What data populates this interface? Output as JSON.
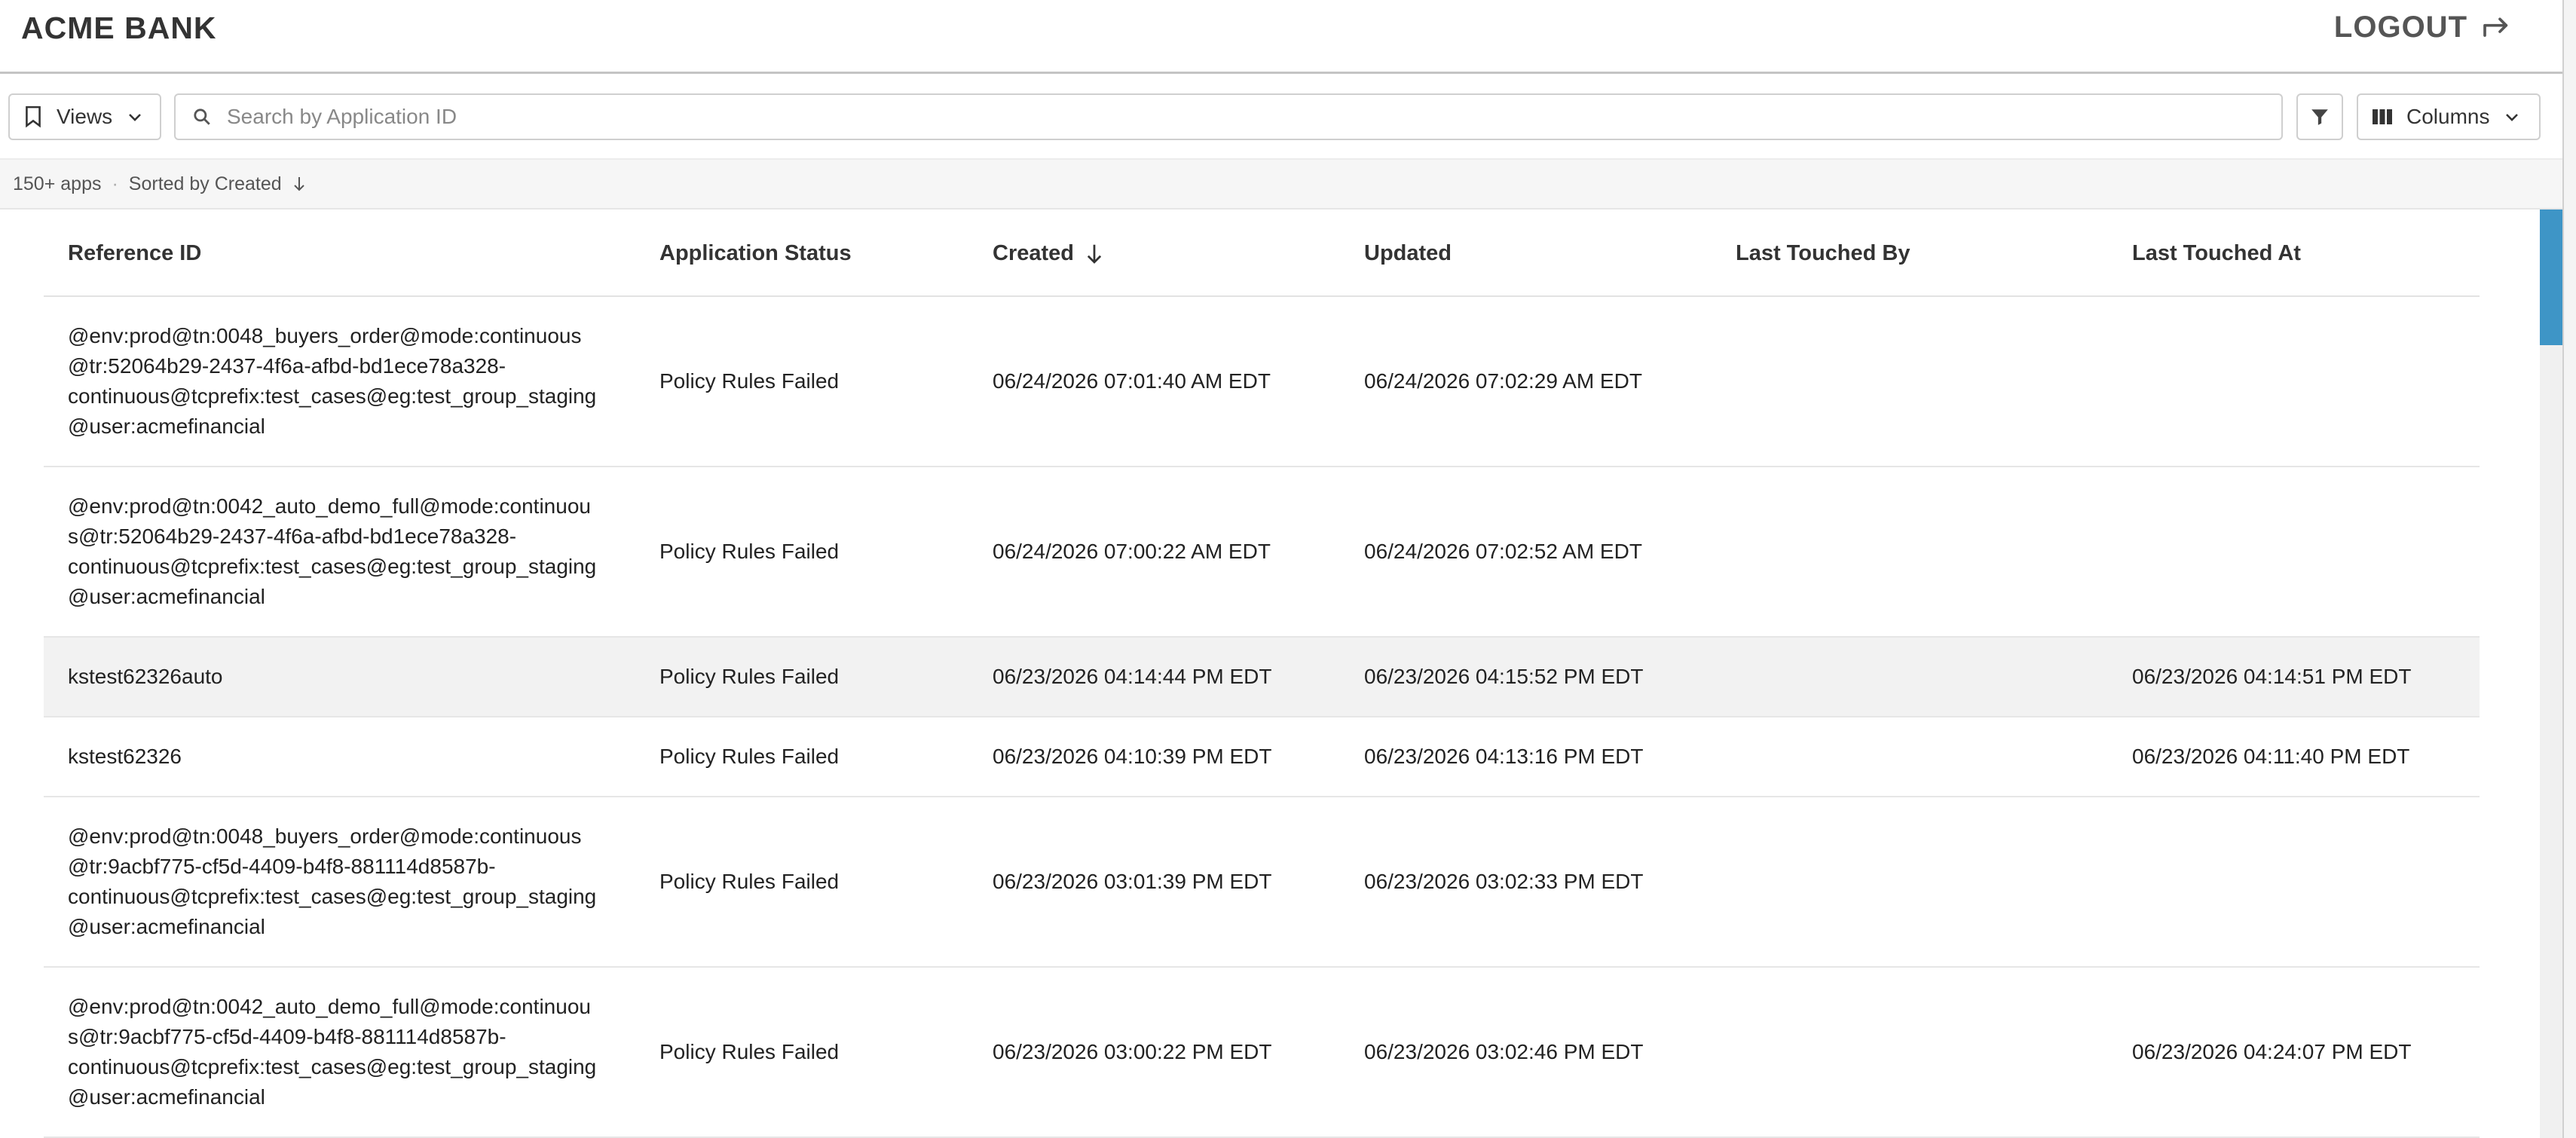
{
  "header": {
    "brand": "ACME BANK",
    "logout_label": "LOGOUT"
  },
  "toolbar": {
    "views_label": "Views",
    "search_placeholder": "Search by Application ID",
    "search_value": "",
    "columns_label": "Columns"
  },
  "status": {
    "count": "150+ apps",
    "sort_label": "Sorted by Created"
  },
  "table": {
    "columns": [
      "Reference ID",
      "Application Status",
      "Created",
      "Updated",
      "Last Touched By",
      "Last Touched At"
    ],
    "rows": [
      {
        "ref_lines": [
          "@env:prod@tn:0048_buyers_order@mode:continuous",
          "@tr:52064b29-2437-4f6a-afbd-bd1ece78a328-",
          "continuous@tcprefix:test_cases@eg:test_group_staging",
          "@user:acmefinancial"
        ],
        "status": "Policy Rules Failed",
        "created": "06/24/2026 07:01:40 AM EDT",
        "updated": "06/24/2026 07:02:29 AM EDT",
        "touched_by": "",
        "touched_at": ""
      },
      {
        "ref_lines": [
          "@env:prod@tn:0042_auto_demo_full@mode:continuou",
          "s@tr:52064b29-2437-4f6a-afbd-bd1ece78a328-",
          "continuous@tcprefix:test_cases@eg:test_group_staging",
          "@user:acmefinancial"
        ],
        "status": "Policy Rules Failed",
        "created": "06/24/2026 07:00:22 AM EDT",
        "updated": "06/24/2026 07:02:52 AM EDT",
        "touched_by": "",
        "touched_at": ""
      },
      {
        "ref_lines": [
          "kstest62326auto"
        ],
        "status": "Policy Rules Failed",
        "created": "06/23/2026 04:14:44 PM EDT",
        "updated": "06/23/2026 04:15:52 PM EDT",
        "touched_by": "",
        "touched_at": "06/23/2026 04:14:51 PM EDT"
      },
      {
        "ref_lines": [
          "kstest62326"
        ],
        "status": "Policy Rules Failed",
        "created": "06/23/2026 04:10:39 PM EDT",
        "updated": "06/23/2026 04:13:16 PM EDT",
        "touched_by": "",
        "touched_at": "06/23/2026 04:11:40 PM EDT"
      },
      {
        "ref_lines": [
          "@env:prod@tn:0048_buyers_order@mode:continuous",
          "@tr:9acbf775-cf5d-4409-b4f8-881114d8587b-",
          "continuous@tcprefix:test_cases@eg:test_group_staging",
          "@user:acmefinancial"
        ],
        "status": "Policy Rules Failed",
        "created": "06/23/2026 03:01:39 PM EDT",
        "updated": "06/23/2026 03:02:33 PM EDT",
        "touched_by": "",
        "touched_at": ""
      },
      {
        "ref_lines": [
          "@env:prod@tn:0042_auto_demo_full@mode:continuou",
          "s@tr:9acbf775-cf5d-4409-b4f8-881114d8587b-",
          "continuous@tcprefix:test_cases@eg:test_group_staging",
          "@user:acmefinancial"
        ],
        "status": "Policy Rules Failed",
        "created": "06/23/2026 03:00:22 PM EDT",
        "updated": "06/23/2026 03:02:46 PM EDT",
        "touched_by": "",
        "touched_at": "06/23/2026 04:24:07 PM EDT"
      }
    ]
  },
  "icons": {
    "views": "bookmark-icon",
    "views_caret": "chevron-down-icon",
    "search": "search-icon",
    "filter": "filter-icon",
    "columns": "columns-icon",
    "columns_caret": "chevron-down-icon",
    "logout": "logout-arrow-icon",
    "sort": "arrow-down-icon"
  },
  "colors": {
    "scroll_accent": "#3e95c6",
    "row_highlight": "#f2f2f2"
  }
}
